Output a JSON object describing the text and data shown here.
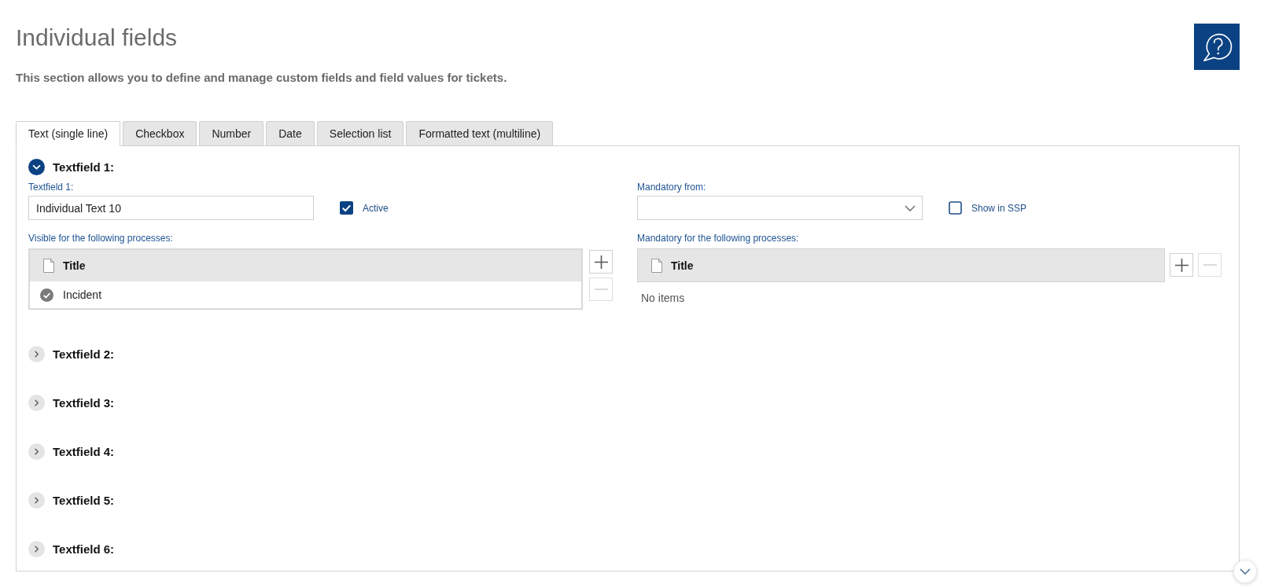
{
  "page": {
    "title": "Individual fields",
    "description": "This section allows you to define and manage custom fields and field values for tickets."
  },
  "tabs": [
    {
      "label": "Text (single line)",
      "selected": true
    },
    {
      "label": "Checkbox",
      "selected": false
    },
    {
      "label": "Number",
      "selected": false
    },
    {
      "label": "Date",
      "selected": false
    },
    {
      "label": "Selection list",
      "selected": false
    },
    {
      "label": "Formatted text (multiline)",
      "selected": false
    }
  ],
  "sections": [
    {
      "title": "Textfield 1:",
      "expanded": true,
      "name_field": {
        "label": "Textfield 1:",
        "value": "Individual Text 10"
      },
      "active": {
        "label": "Active",
        "checked": true
      },
      "mandatory_from": {
        "label": "Mandatory from:"
      },
      "show_in_ssp": {
        "label": "Show in SSP",
        "checked": false
      },
      "visible_processes": {
        "label": "Visible for the following processes:",
        "columns": [
          "Title"
        ],
        "rows": [
          {
            "title": "Incident"
          }
        ],
        "buttons": [
          {
            "kind": "add",
            "disabled": false
          },
          {
            "kind": "remove",
            "disabled": true
          }
        ]
      },
      "mandatory_processes": {
        "label": "Mandatory for the following processes:",
        "columns": [
          "Title"
        ],
        "empty_text": "No items",
        "buttons": [
          {
            "kind": "add",
            "disabled": false
          },
          {
            "kind": "remove",
            "disabled": true
          }
        ]
      }
    },
    {
      "title": "Textfield 2:",
      "expanded": false
    },
    {
      "title": "Textfield 3:",
      "expanded": false
    },
    {
      "title": "Textfield 4:",
      "expanded": false
    },
    {
      "title": "Textfield 5:",
      "expanded": false
    },
    {
      "title": "Textfield 6:",
      "expanded": false
    }
  ]
}
